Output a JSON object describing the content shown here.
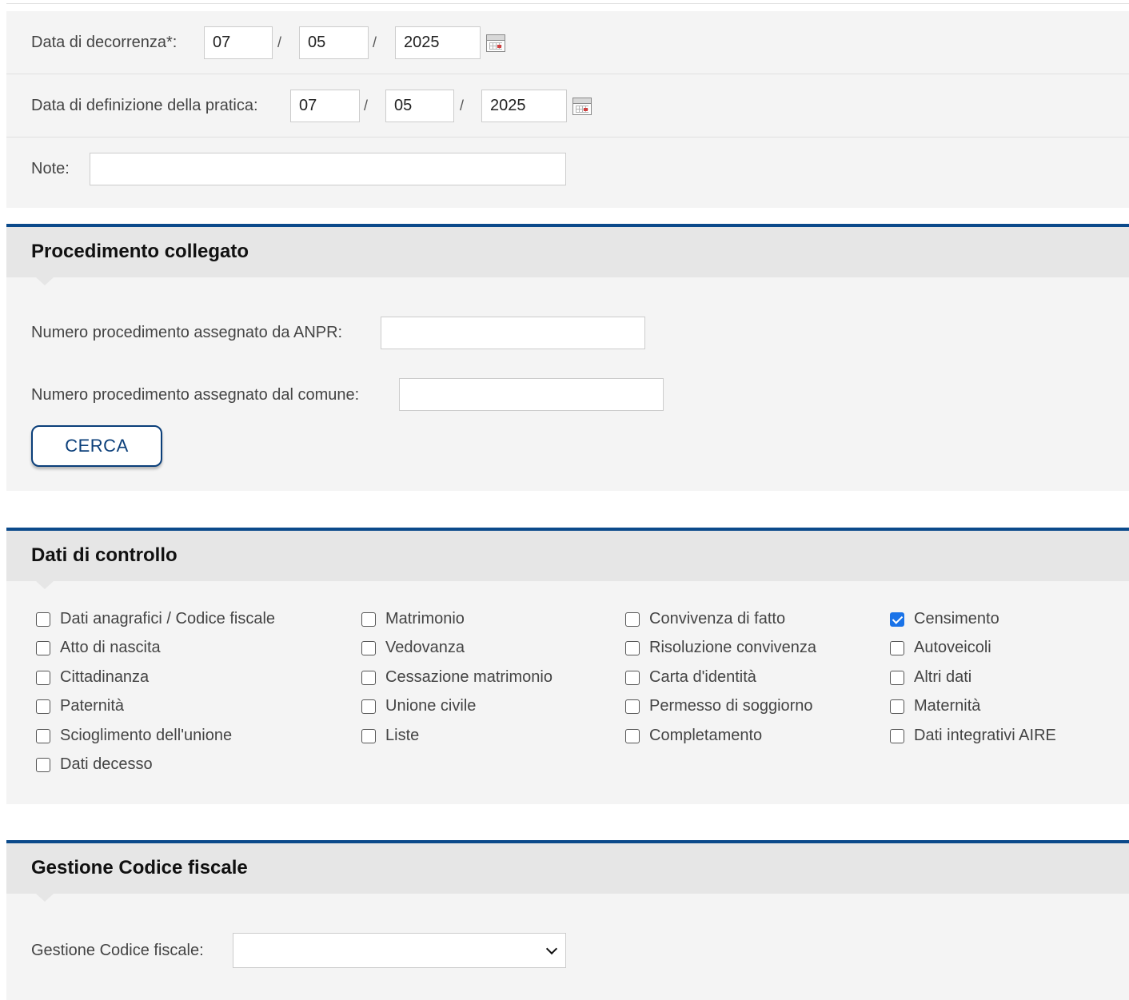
{
  "form": {
    "decorrenza": {
      "label": "Data di decorrenza*:",
      "day": "07",
      "month": "05",
      "year": "2025",
      "sep": "/"
    },
    "definizione": {
      "label": "Data di definizione della pratica:",
      "day": "07",
      "month": "05",
      "year": "2025",
      "sep": "/"
    },
    "note": {
      "label": "Note:",
      "value": ""
    }
  },
  "procedimento": {
    "title": "Procedimento collegato",
    "anpr_label": "Numero procedimento assegnato da ANPR:",
    "anpr_value": "",
    "comune_label": "Numero procedimento assegnato dal comune:",
    "comune_value": "",
    "search_button": "CERCA"
  },
  "controllo": {
    "title": "Dati di controllo",
    "items": [
      {
        "label": "Dati anagrafici / Codice fiscale",
        "checked": false
      },
      {
        "label": "Atto di nascita",
        "checked": false
      },
      {
        "label": "Cittadinanza",
        "checked": false
      },
      {
        "label": "Paternità",
        "checked": false
      },
      {
        "label": "Scioglimento dell'unione",
        "checked": false
      },
      {
        "label": "Dati decesso",
        "checked": false
      },
      {
        "label": "Matrimonio",
        "checked": false
      },
      {
        "label": "Vedovanza",
        "checked": false
      },
      {
        "label": "Cessazione matrimonio",
        "checked": false
      },
      {
        "label": "Unione civile",
        "checked": false
      },
      {
        "label": "Liste",
        "checked": false
      },
      {
        "label": "Convivenza di fatto",
        "checked": false
      },
      {
        "label": "Risoluzione convivenza",
        "checked": false
      },
      {
        "label": "Carta d'identità",
        "checked": false
      },
      {
        "label": "Permesso di soggiorno",
        "checked": false
      },
      {
        "label": "Completamento",
        "checked": false
      },
      {
        "label": "Censimento",
        "checked": true
      },
      {
        "label": "Autoveicoli",
        "checked": false
      },
      {
        "label": "Altri dati",
        "checked": false
      },
      {
        "label": "Maternità",
        "checked": false
      },
      {
        "label": "Dati integrativi AIRE",
        "checked": false
      }
    ]
  },
  "codice_fiscale": {
    "title": "Gestione Codice fiscale",
    "select_label": "Gestione Codice fiscale:",
    "select_value": ""
  },
  "colors": {
    "accent": "#0b4a8b",
    "checkbox_checked": "#1a73e8",
    "panel_bg": "#f4f4f4",
    "header_bg": "#e6e6e6"
  }
}
